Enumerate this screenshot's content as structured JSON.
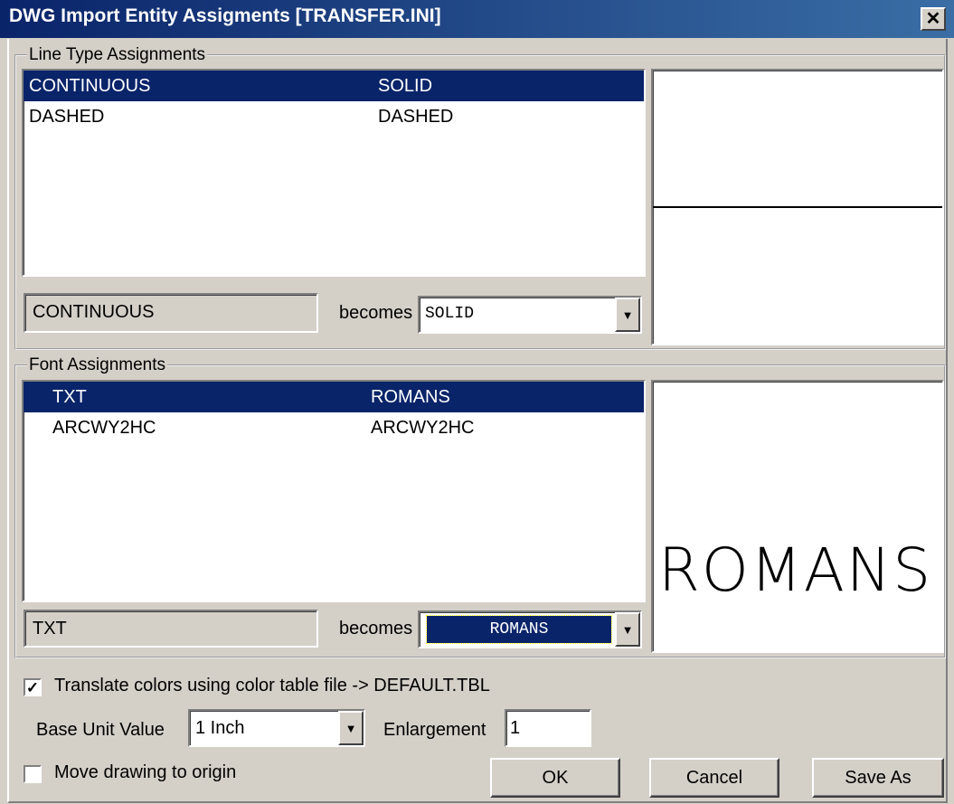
{
  "window": {
    "title": "DWG Import Entity Assigments [TRANSFER.INI]",
    "close_glyph": "✕"
  },
  "line_types": {
    "legend": "Line Type Assignments",
    "rows": [
      {
        "from": "CONTINUOUS",
        "to": "SOLID",
        "selected": true
      },
      {
        "from": "DASHED",
        "to": "DASHED",
        "selected": false
      }
    ],
    "current_from": "CONTINUOUS",
    "becomes_label": "becomes",
    "combo_value": "SOLID"
  },
  "fonts": {
    "legend": "Font Assignments",
    "rows": [
      {
        "from": "TXT",
        "to": "ROMANS",
        "selected": true
      },
      {
        "from": "ARCWY2HC",
        "to": "ARCWY2HC",
        "selected": false
      }
    ],
    "current_from": "TXT",
    "becomes_label": "becomes",
    "combo_value": "ROMANS",
    "preview_text": "ROMANS"
  },
  "options": {
    "translate_colors_label": "Translate colors using color table file  -> DEFAULT.TBL",
    "translate_colors_checked": true,
    "base_unit_label": "Base Unit Value",
    "base_unit_value": "1 Inch",
    "enlargement_label": "Enlargement",
    "enlargement_value": "1",
    "move_origin_label": "Move drawing to origin",
    "move_origin_checked": false
  },
  "buttons": {
    "ok": "OK",
    "cancel": "Cancel",
    "save_as": "Save As"
  },
  "icons": {
    "dropdown": "▼",
    "check": "✓"
  },
  "colors": {
    "title_bar": "#0a246a",
    "selection": "#0a246a",
    "face": "#d4d0c8"
  }
}
